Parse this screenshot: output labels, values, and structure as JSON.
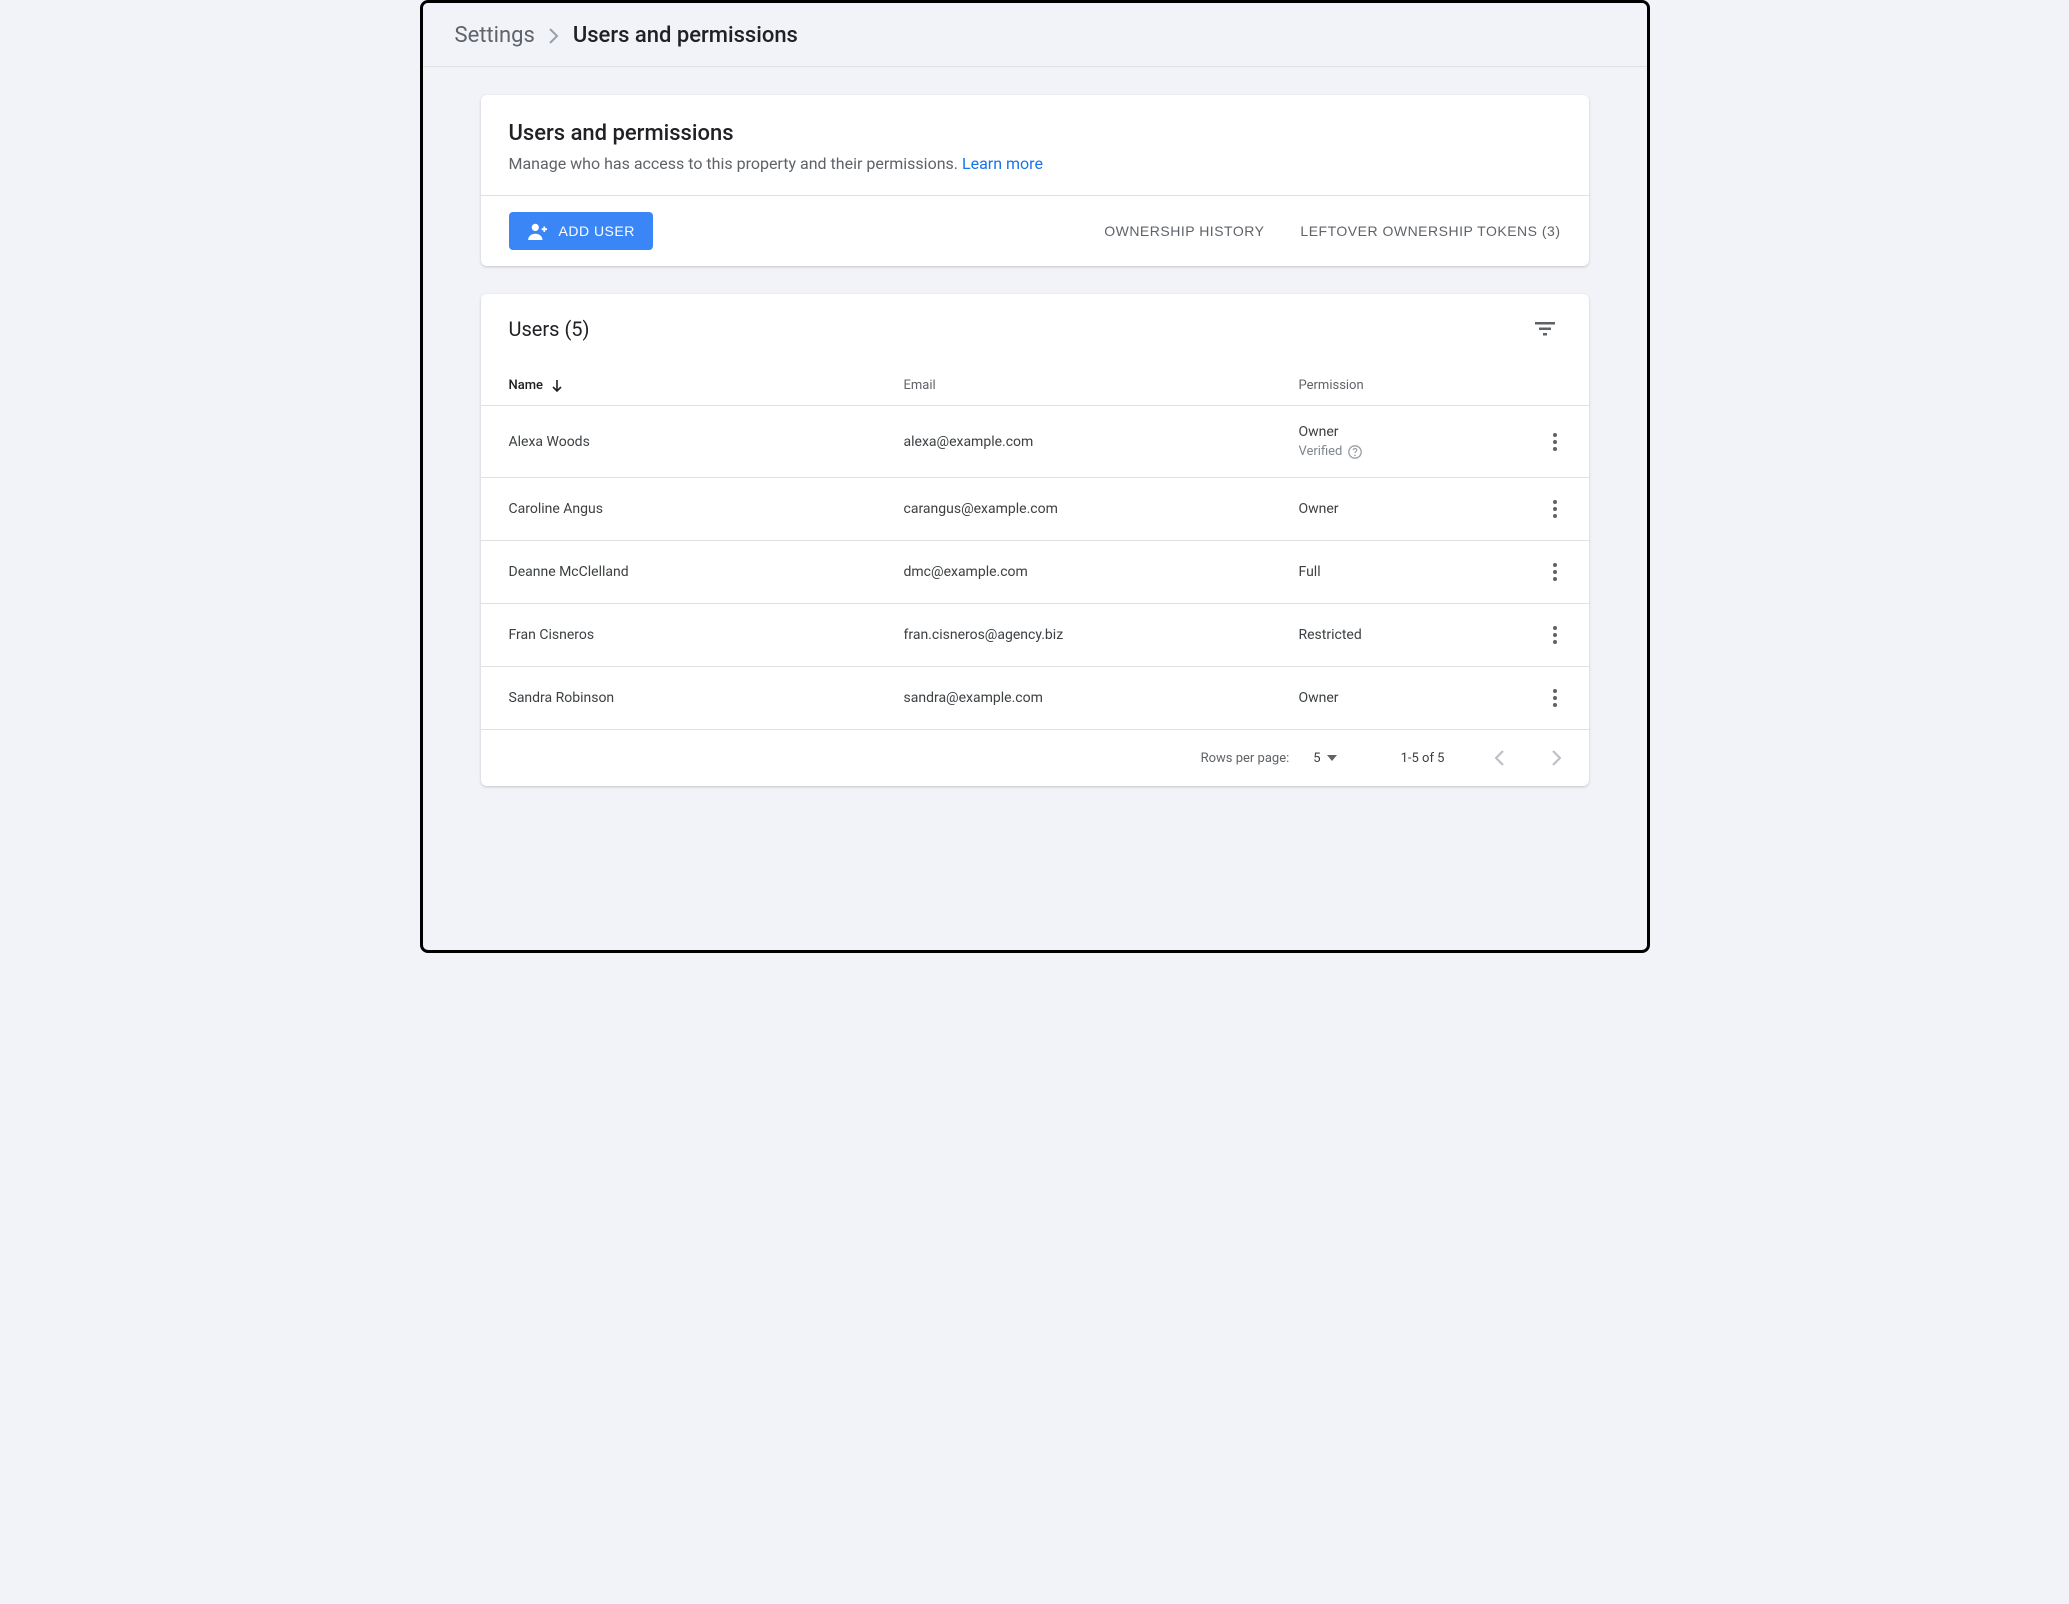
{
  "breadcrumb": {
    "root": "Settings",
    "current": "Users and permissions"
  },
  "header": {
    "title": "Users and permissions",
    "description": "Manage who has access to this property and their permissions. ",
    "learn_more": "Learn more"
  },
  "toolbar": {
    "add_user_label": "ADD USER",
    "ownership_history_label": "OWNERSHIP HISTORY",
    "leftover_tokens_label": "LEFTOVER OWNERSHIP TOKENS (3)"
  },
  "table": {
    "title": "Users (5)",
    "columns": {
      "name": "Name",
      "email": "Email",
      "permission": "Permission"
    },
    "rows": [
      {
        "name": "Alexa Woods",
        "email": "alexa@example.com",
        "permission": "Owner",
        "verified_label": "Verified"
      },
      {
        "name": "Caroline Angus",
        "email": "carangus@example.com",
        "permission": "Owner"
      },
      {
        "name": "Deanne McClelland",
        "email": "dmc@example.com",
        "permission": "Full"
      },
      {
        "name": "Fran Cisneros",
        "email": "fran.cisneros@agency.biz",
        "permission": "Restricted"
      },
      {
        "name": "Sandra Robinson",
        "email": "sandra@example.com",
        "permission": "Owner"
      }
    ]
  },
  "pagination": {
    "rows_per_page_label": "Rows per page:",
    "rows_per_page_value": "5",
    "range": "1-5 of 5"
  }
}
